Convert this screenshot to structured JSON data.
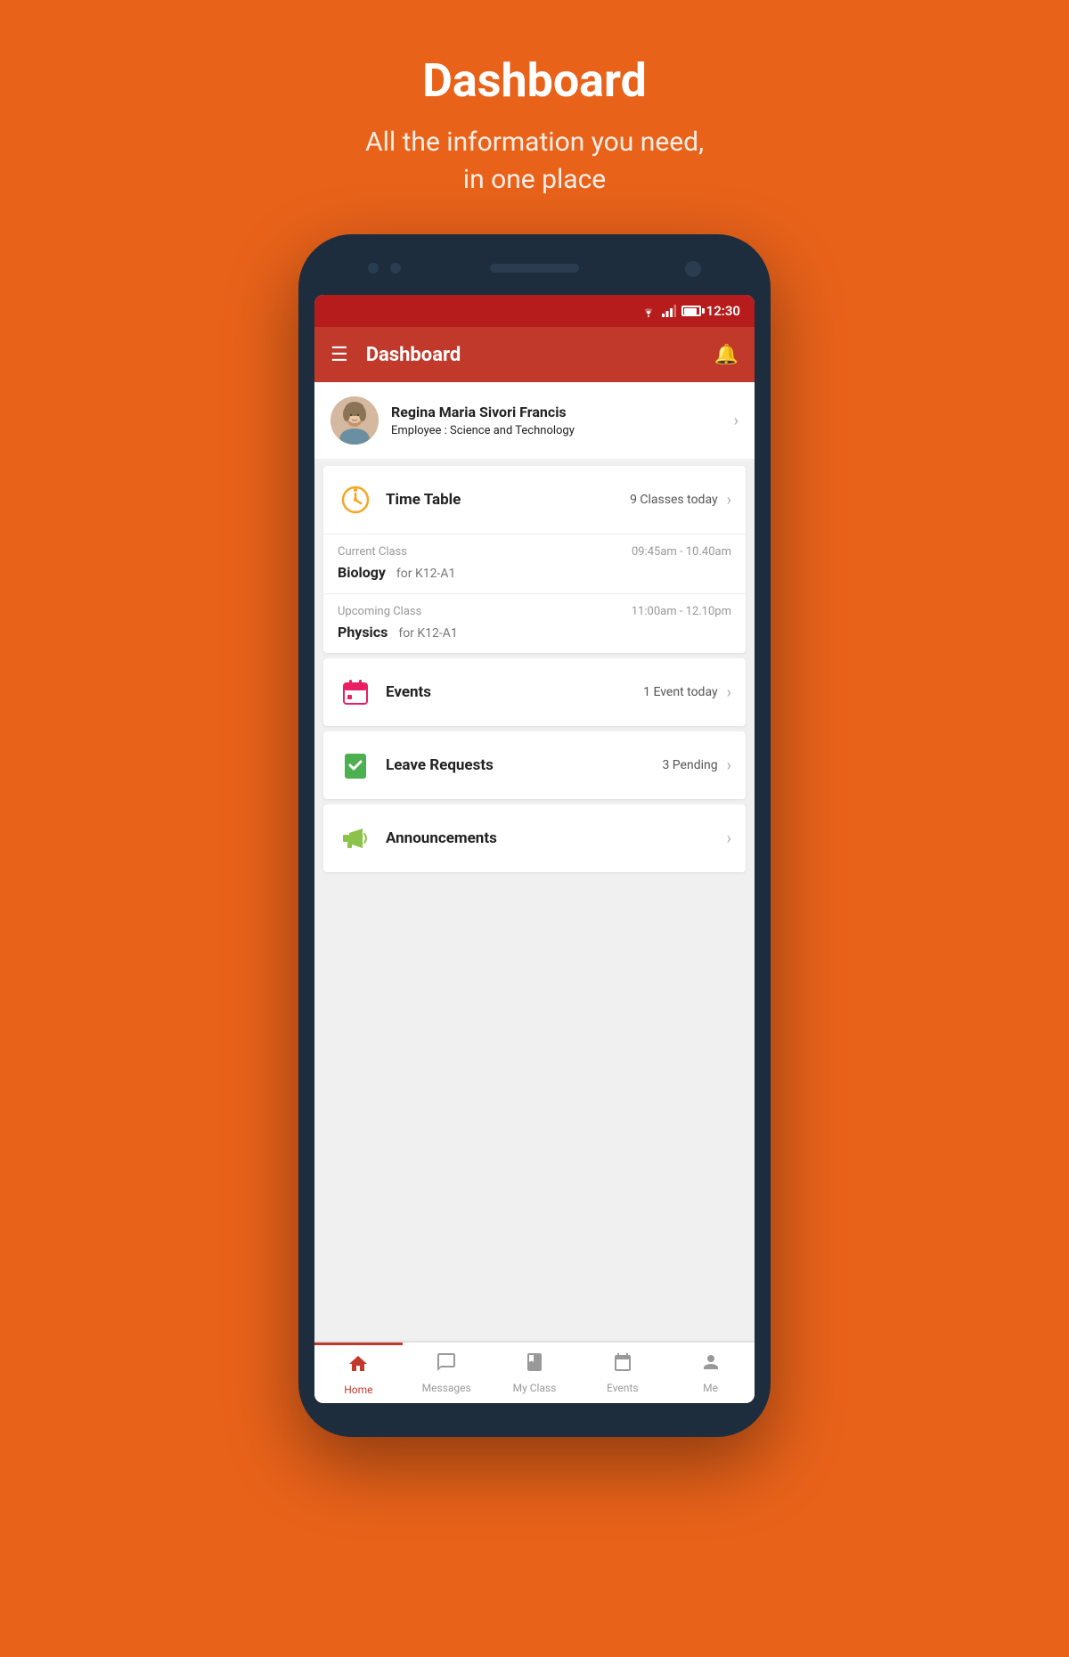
{
  "page": {
    "title": "Dashboard",
    "subtitle_line1": "All the information you need,",
    "subtitle_line2": "in one place"
  },
  "status_bar": {
    "time": "12:30"
  },
  "app_bar": {
    "title": "Dashboard"
  },
  "profile": {
    "name": "Regina Maria Sivori Francis",
    "role_label": "Employee :",
    "role_value": "Science and Technology"
  },
  "timetable_card": {
    "title": "Time Table",
    "badge": "9 Classes today",
    "current_class_label": "Current Class",
    "current_class_time": "09:45am - 10.40am",
    "current_class_name": "Biology",
    "current_class_group": "for K12-A1",
    "upcoming_class_label": "Upcoming Class",
    "upcoming_class_time": "11:00am - 12.10pm",
    "upcoming_class_name": "Physics",
    "upcoming_class_group": "for K12-A1"
  },
  "events_card": {
    "title": "Events",
    "badge": "1 Event today"
  },
  "leave_card": {
    "title": "Leave Requests",
    "badge": "3 Pending"
  },
  "announcements_card": {
    "title": "Announcements"
  },
  "bottom_nav": {
    "items": [
      {
        "label": "Home",
        "active": true
      },
      {
        "label": "Messages",
        "active": false
      },
      {
        "label": "My Class",
        "active": false
      },
      {
        "label": "Events",
        "active": false
      },
      {
        "label": "Me",
        "active": false
      }
    ]
  }
}
